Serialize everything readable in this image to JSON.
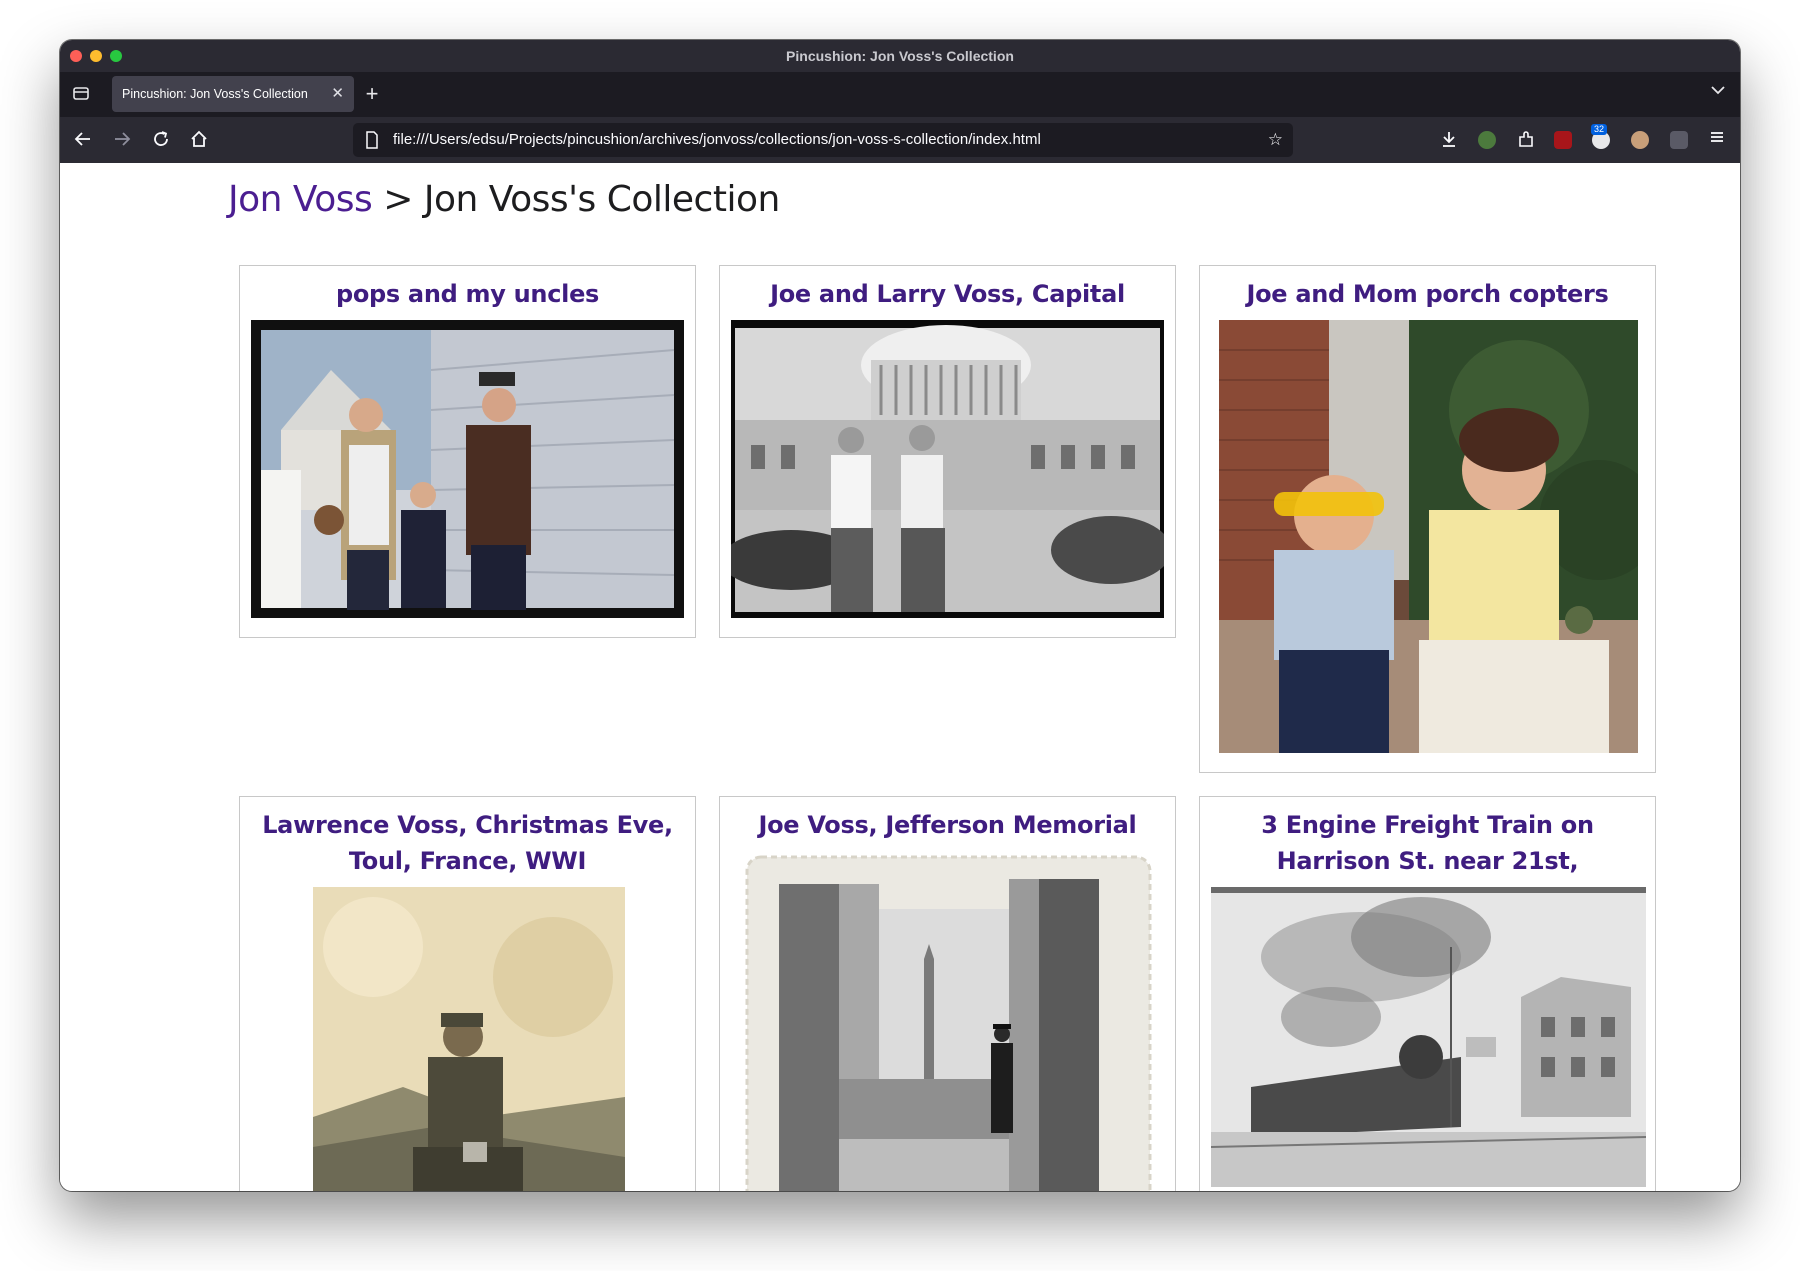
{
  "window": {
    "title": "Pincushion: Jon Voss's Collection"
  },
  "tabs": [
    {
      "label": "Pincushion: Jon Voss's Collection",
      "active": true
    }
  ],
  "address_bar": {
    "url": "file:///Users/edsu/Projects/pincushion/archives/jonvoss/collections/jon-voss-s-collection/index.html"
  },
  "toolbar": {
    "extension_badge": "32"
  },
  "page": {
    "breadcrumb_link": "Jon Voss",
    "breadcrumb_separator": ">",
    "breadcrumb_current": "Jon Voss's Collection",
    "link_color": "#4b1e91"
  },
  "cards": [
    {
      "title": "pops and my uncles"
    },
    {
      "title": "Joe and Larry Voss, Capital"
    },
    {
      "title": "Joe and Mom porch copters"
    },
    {
      "title": "Lawrence Voss, Christmas Eve, Toul, France, WWI"
    },
    {
      "title": "Joe Voss, Jefferson Memorial"
    },
    {
      "title": "3 Engine Freight Train on Harrison St. near 21st,"
    }
  ]
}
